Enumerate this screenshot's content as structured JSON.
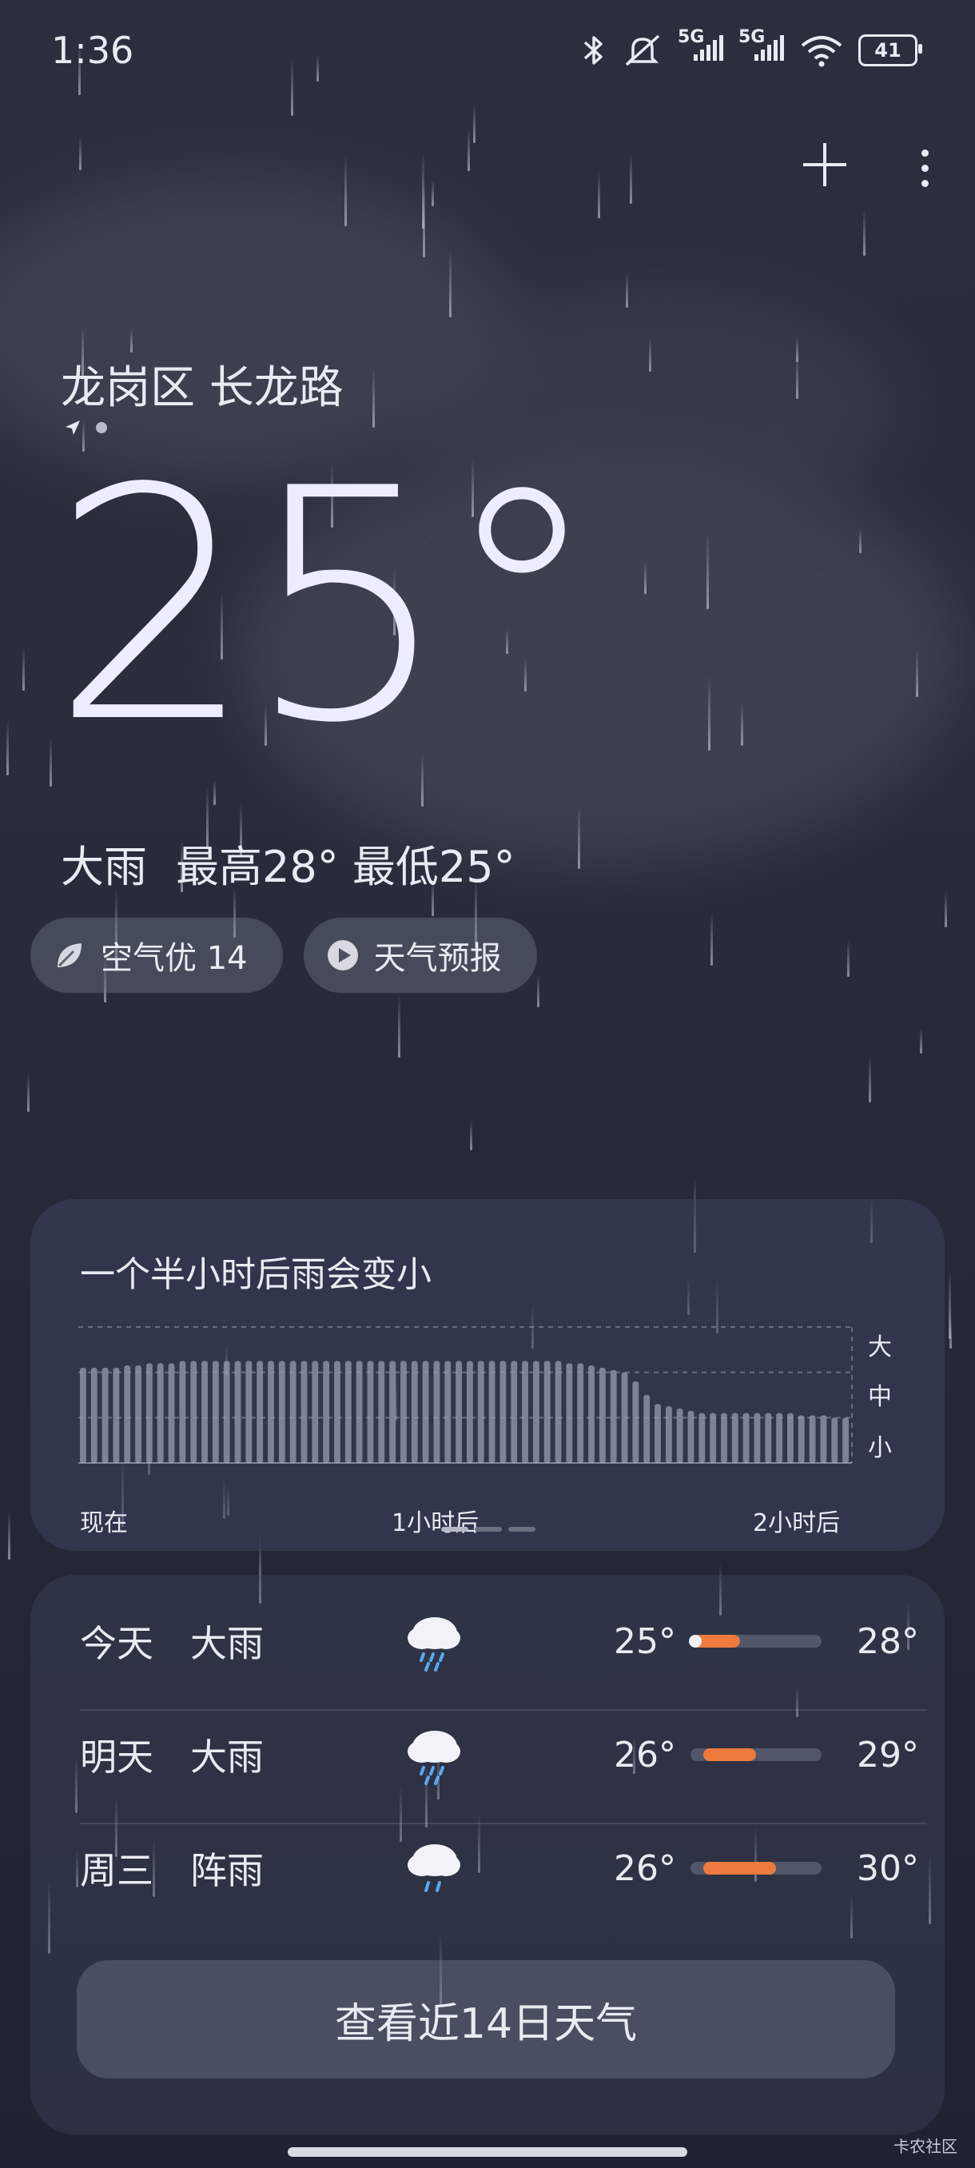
{
  "status_bar": {
    "time": "1:36",
    "signal1": "5G",
    "signal2": "5G",
    "battery": "41"
  },
  "location": {
    "name": "龙岗区 长龙路"
  },
  "current": {
    "temperature": "25°",
    "condition": "大雨",
    "high": "最高28°",
    "low": "最低25°"
  },
  "chips": {
    "air_quality": "空气优 14",
    "forecast_video": "天气预报"
  },
  "rain_card": {
    "title": "一个半小时后雨会变小",
    "x_labels": [
      "现在",
      "1小时后",
      "2小时后"
    ],
    "y_labels": [
      "大",
      "中",
      "小"
    ]
  },
  "chart_data": {
    "type": "bar",
    "title": "一个半小时后雨会变小",
    "x_tick_labels": [
      "现在",
      "1小时后",
      "2小时后"
    ],
    "y_tick_labels": [
      "小",
      "中",
      "大"
    ],
    "ylim": [
      0,
      3
    ],
    "values": [
      2.1,
      2.1,
      2.1,
      2.1,
      2.15,
      2.15,
      2.2,
      2.2,
      2.2,
      2.25,
      2.25,
      2.25,
      2.25,
      2.25,
      2.25,
      2.25,
      2.25,
      2.25,
      2.25,
      2.25,
      2.25,
      2.25,
      2.25,
      2.25,
      2.25,
      2.25,
      2.25,
      2.25,
      2.25,
      2.25,
      2.25,
      2.25,
      2.25,
      2.25,
      2.25,
      2.25,
      2.25,
      2.25,
      2.25,
      2.25,
      2.25,
      2.25,
      2.25,
      2.25,
      2.2,
      2.2,
      2.15,
      2.1,
      2.05,
      2.0,
      1.8,
      1.5,
      1.3,
      1.25,
      1.2,
      1.15,
      1.1,
      1.1,
      1.1,
      1.1,
      1.1,
      1.1,
      1.1,
      1.1,
      1.1,
      1.05,
      1.05,
      1.05,
      1.0,
      1.0
    ],
    "grid": true
  },
  "forecast": [
    {
      "day": "今天",
      "condition": "大雨",
      "low": "25°",
      "high": "28°",
      "range": [
        0.0,
        0.38
      ]
    },
    {
      "day": "明天",
      "condition": "大雨",
      "low": "26°",
      "high": "29°",
      "range": [
        0.1,
        0.5
      ]
    },
    {
      "day": "周三",
      "condition": "阵雨",
      "low": "26°",
      "high": "30°",
      "range": [
        0.1,
        0.65
      ]
    }
  ],
  "more_button": "查看近14日天气",
  "watermark": "卡农社区"
}
